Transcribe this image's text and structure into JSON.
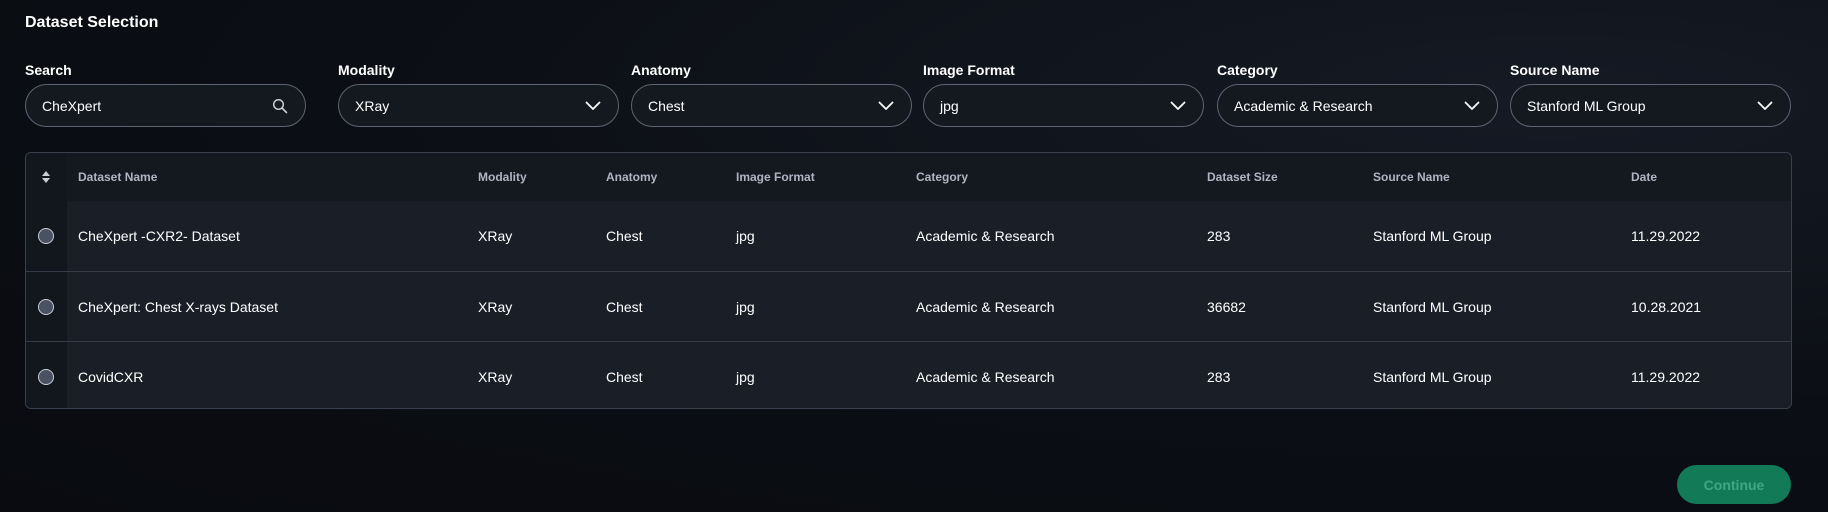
{
  "page": {
    "title": "Dataset Selection"
  },
  "filters": {
    "search": {
      "label": "Search",
      "value": "CheXpert",
      "icon": "search-icon"
    },
    "modality": {
      "label": "Modality",
      "value": "XRay"
    },
    "anatomy": {
      "label": "Anatomy",
      "value": "Chest"
    },
    "image_format": {
      "label": "Image Format",
      "value": "jpg"
    },
    "category": {
      "label": "Category",
      "value": "Academic & Research"
    },
    "source_name": {
      "label": "Source Name",
      "value": "Stanford ML Group"
    }
  },
  "table": {
    "columns": {
      "name": "Dataset Name",
      "modality": "Modality",
      "anatomy": "Anatomy",
      "image_format": "Image Format",
      "category": "Category",
      "size": "Dataset Size",
      "source": "Source Name",
      "date": "Date"
    },
    "rows": [
      {
        "name": "CheXpert -CXR2- Dataset",
        "modality": "XRay",
        "anatomy": "Chest",
        "image_format": "jpg",
        "category": "Academic & Research",
        "size": "283",
        "source": "Stanford ML Group",
        "date": "11.29.2022"
      },
      {
        "name": "CheXpert: Chest X-rays Dataset",
        "modality": "XRay",
        "anatomy": "Chest",
        "image_format": "jpg",
        "category": "Academic & Research",
        "size": "36682",
        "source": "Stanford ML Group",
        "date": "10.28.2021"
      },
      {
        "name": "CovidCXR",
        "modality": "XRay",
        "anatomy": "Chest",
        "image_format": "jpg",
        "category": "Academic & Research",
        "size": "283",
        "source": "Stanford ML Group",
        "date": "11.29.2022"
      }
    ]
  },
  "actions": {
    "continue_label": "Continue"
  },
  "colors": {
    "background": "#0b0e14",
    "border": "#5d6472",
    "row_background": "#1a1e27",
    "header_text": "#aeb6c4",
    "accent": "#137a57",
    "accent_text": "#3fa882"
  }
}
